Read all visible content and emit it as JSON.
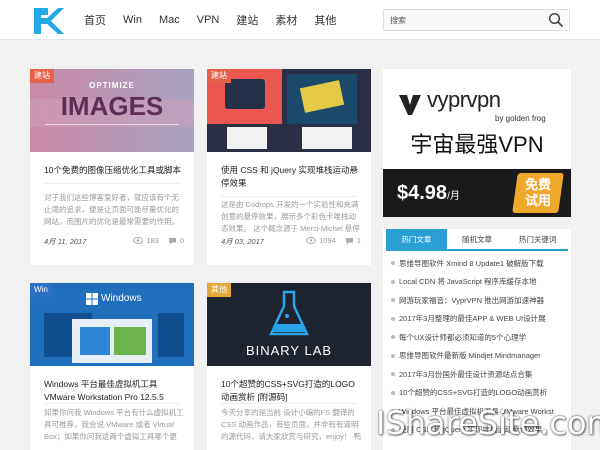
{
  "nav": [
    "首页",
    "Win",
    "Mac",
    "VPN",
    "建站",
    "素材",
    "其他"
  ],
  "search": {
    "placeholder": "搜索"
  },
  "cards": [
    {
      "tag": "建站",
      "tag_color": "#e5614a",
      "thumb_text": "IMAGES",
      "thumb_sub": "OPTIMIZE",
      "title": "10个免费的图像压缩优化工具或脚本",
      "excerpt": "对于我们这些博客爱好者，就应该有个无止境的追求，便是让页面可能尽量优化的网站，而图片的优化是最常需要的作用。 没经过",
      "date": "4月 11, 2017",
      "views": "183",
      "comments": "0"
    },
    {
      "tag": "建站",
      "tag_color": "#e5614a",
      "title": "使用 CSS 和 jQuery 实现堆栈运动悬停效果",
      "excerpt": "这是由 Codrops 开发的一个实验性和充满创意的悬停效果，展示多个彩色卡堆栈动态效果。 这个概念源于 Merci-Michel 悬停效",
      "date": "4月 03, 2017",
      "views": "1094",
      "comments": "1"
    },
    {
      "tag": "Win",
      "tag_color": "#2d6fc4",
      "thumb_text": "Windows",
      "title": "Windows 平台最佳虚拟机工具 VMware Workstation Pro 12.5.5",
      "excerpt": "如果你问我 Windows 平台有什么虚拟机工具可推荐，我会说 VMware 或者 Virtual Box；如果你问我这两个虚拟工具哪个更",
      "date": "",
      "views": "",
      "comments": ""
    },
    {
      "tag": "其他",
      "tag_color": "#e0a93a",
      "thumb_text": "BINARY LAB",
      "title": "10个超赞的CSS+SVG打造的LOGO动画赏析 [附源码]",
      "excerpt": "今天分享的是当前 设计小编的FS 翻译的CSS 动画作品，有些页面，并非有有道明的源代码，请大家欣赏与研究，enjoy！ 鸭们建议",
      "date": "",
      "views": "",
      "comments": ""
    }
  ],
  "ad": {
    "brand": "vyprvpn",
    "byline": "by golden frog",
    "slogan": "宇宙最强VPN",
    "price": "$4.98",
    "price_unit": "/月",
    "free": "免费试用"
  },
  "tabs": [
    "热门文章",
    "随机文章",
    "热门关键词"
  ],
  "list": [
    "思维导图软件 Xmind 8 Update1 破解版下载",
    "Local CDN 将 JavaScript 程序库缓存本地",
    "网游玩家福音：VyprVPN 推出网游加速神器",
    "2017年3月整理的最佳APP & WEB UI设计展",
    "每个UX设计师都必须知道的5个心理学",
    "思维导图软件最新版 Mindjet Mindmanager",
    "2017年3月份国外最佳设计资源站点合集",
    "10个超赞的CSS+SVG打造的LOGO动画赏析",
    "Windows 平台最佳虚拟机工具 VMware Workst",
    "使用 CSS 和 jQuery 实现堆栈运动悬停效果"
  ],
  "watermark": "IShareSite.com"
}
